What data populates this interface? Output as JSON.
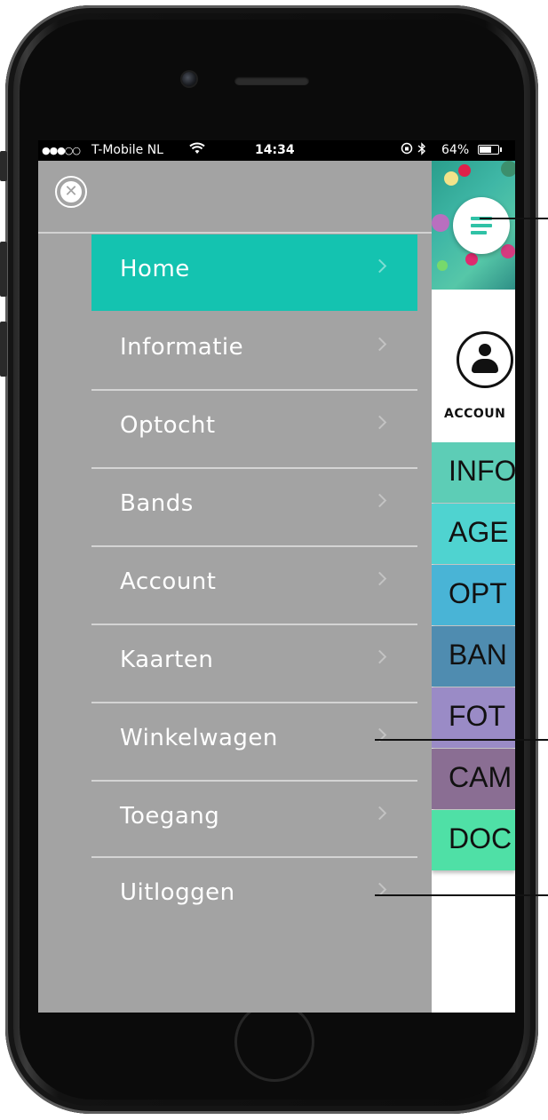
{
  "status_bar": {
    "signal": "●●●○○",
    "carrier": "T-Mobile NL",
    "wifi_icon": "wifi-icon",
    "time": "14:34",
    "lock_icon": "orientation-lock-icon",
    "bluetooth_icon": "bluetooth-icon",
    "battery_percent": "64%",
    "battery_level": 0.64
  },
  "drawer": {
    "close_icon": "close-icon",
    "active_color": "#14c3b0",
    "background_color": "#a3a3a3",
    "items": [
      {
        "label": "Home",
        "active": true
      },
      {
        "label": "Informatie",
        "active": false
      },
      {
        "label": "Optocht",
        "active": false
      },
      {
        "label": "Bands",
        "active": false
      },
      {
        "label": "Account",
        "active": false
      },
      {
        "label": "Kaarten",
        "active": false
      },
      {
        "label": "Winkelwagen",
        "active": false
      },
      {
        "label": "Toegang",
        "active": false
      },
      {
        "label": "Uitloggen",
        "active": false
      }
    ]
  },
  "app": {
    "menu_icon": "hamburger-menu-icon",
    "account_icon": "user-icon",
    "account_label": "ACCOUN",
    "tiles": [
      {
        "label": "INFO",
        "color": "#5dcdb6"
      },
      {
        "label": "AGE",
        "color": "#4fd3d0"
      },
      {
        "label": "OPT",
        "color": "#49b4d6"
      },
      {
        "label": "BAN",
        "color": "#4f8cb0"
      },
      {
        "label": "FOT",
        "color": "#9a8bc6"
      },
      {
        "label": "CAM",
        "color": "#8a6e93"
      },
      {
        "label": "DOC",
        "color": "#4fe0a6"
      }
    ]
  }
}
